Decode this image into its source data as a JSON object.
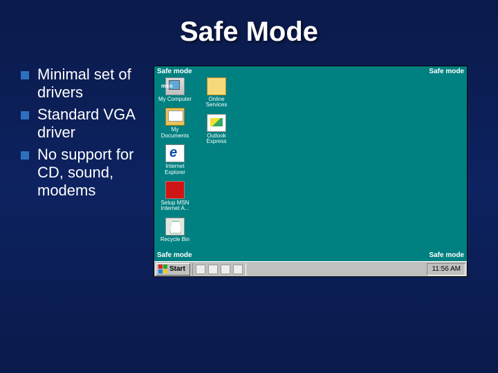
{
  "title": "Safe Mode",
  "bullets": [
    "Minimal set of drivers",
    "Standard VGA driver",
    "No support for CD, sound, modems"
  ],
  "screenshot": {
    "corner_label": "Safe mode",
    "desktop_icons_col1": [
      {
        "name": "my-computer",
        "label": "My Computer",
        "cls": "computer"
      },
      {
        "name": "my-documents",
        "label": "My Documents",
        "cls": "folder2"
      },
      {
        "name": "internet-explorer",
        "label": "Internet Explorer",
        "cls": "ie"
      },
      {
        "name": "setup-msn",
        "label": "Setup MSN Internet A...",
        "cls": "msn"
      },
      {
        "name": "recycle-bin",
        "label": "Recycle Bin",
        "cls": "recycle"
      }
    ],
    "desktop_icons_col2": [
      {
        "name": "online-services",
        "label": "Online Services",
        "cls": "folder"
      },
      {
        "name": "outlook-express",
        "label": "Outlook Express",
        "cls": "outlook"
      }
    ],
    "taskbar": {
      "start_label": "Start",
      "clock": "11:56 AM"
    }
  }
}
